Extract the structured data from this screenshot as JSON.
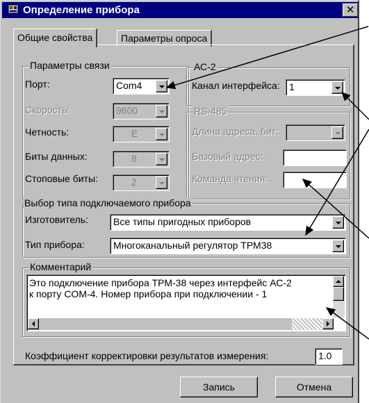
{
  "window": {
    "title": "Определение прибора",
    "close_label": "✕"
  },
  "tabs": [
    {
      "label": "Общие свойства",
      "active": true
    },
    {
      "label": "Параметры опроса",
      "active": false
    }
  ],
  "connection": {
    "legend": "Параметры связи",
    "port_label": "Порт:",
    "port_value": "Com4",
    "speed_label": "Скорость:",
    "speed_value": "9600",
    "parity_label": "Четность:",
    "parity_value": "E",
    "databits_label": "Биты данных:",
    "databits_value": "8",
    "stopbits_label": "Стоповые биты:",
    "stopbits_value": "2"
  },
  "ac2": {
    "legend": "АС-2",
    "channel_label": "Канал интерфейса:",
    "channel_value": "1"
  },
  "rs485": {
    "legend": "RS-485",
    "addr_len_label": "Длина адреса, бит:",
    "addr_len_value": "",
    "base_addr_label": "Базовый адрес:",
    "base_addr_value": "",
    "read_cmd_label": "Команда чтения:",
    "read_cmd_value": ""
  },
  "device": {
    "legend": "Выбор типа подключаемого прибора",
    "maker_label": "Изготовитель:",
    "maker_value": "Все типы пригодных приборов",
    "type_label": "Тип прибора:",
    "type_value": "Многоканальный регулятор ТРМ38"
  },
  "comment": {
    "legend": "Комментарий",
    "line1": "Это подключение прибора ТРМ-38 через интерфейс АС-2",
    "line2": "к порту COM-4. Номер прибора при подключении - 1"
  },
  "correction": {
    "label": "Коэффициент корректировки результатов измерения:",
    "value": "1.0"
  },
  "buttons": {
    "save": "Запись",
    "cancel": "Отмена"
  },
  "colors": {
    "titlebar": "#000080",
    "face": "#c0c0c0"
  }
}
